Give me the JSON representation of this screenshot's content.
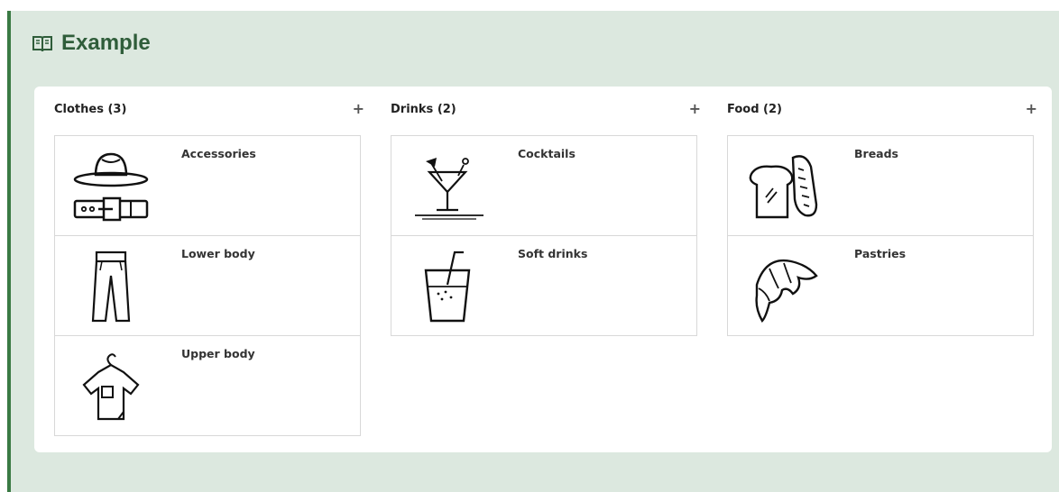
{
  "panel": {
    "title": "Example",
    "title_icon": "book-open-icon",
    "accent": "#3a7a44",
    "background": "#dce8df"
  },
  "columns": [
    {
      "title": "Clothes (3)",
      "add_label": "+",
      "cards": [
        {
          "label": "Accessories",
          "icon": "hat-belt-icon"
        },
        {
          "label": "Lower body",
          "icon": "trousers-icon"
        },
        {
          "label": "Upper body",
          "icon": "tshirt-icon"
        }
      ]
    },
    {
      "title": "Drinks (2)",
      "add_label": "+",
      "cards": [
        {
          "label": "Cocktails",
          "icon": "cocktail-icon"
        },
        {
          "label": "Soft drinks",
          "icon": "soft-drink-icon"
        }
      ]
    },
    {
      "title": "Food (2)",
      "add_label": "+",
      "cards": [
        {
          "label": "Breads",
          "icon": "bread-icon"
        },
        {
          "label": "Pastries",
          "icon": "croissant-icon"
        }
      ]
    }
  ]
}
